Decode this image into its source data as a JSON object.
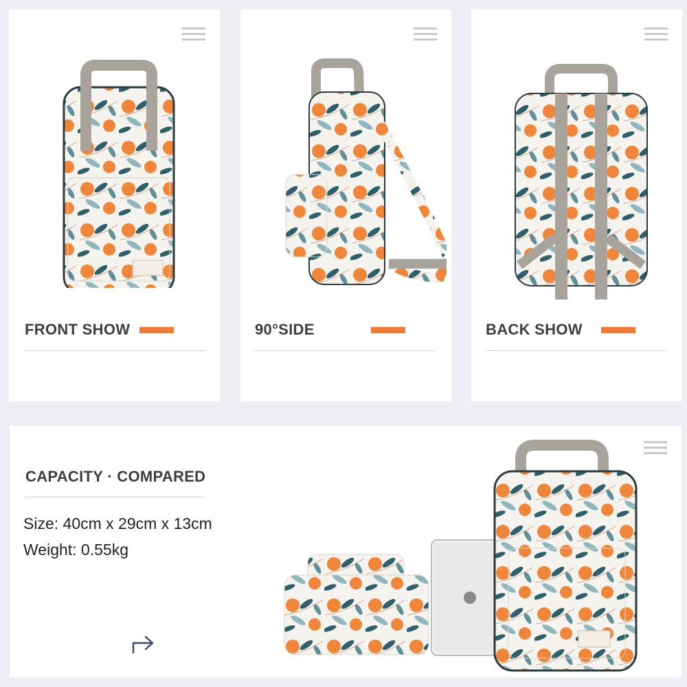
{
  "colors": {
    "page_bg": "#eeeef5",
    "accent": "#f07a3a",
    "pattern_orange": "#f0863a",
    "pattern_leaf": "#2f5f6a",
    "pattern_leaf_light": "#8fb7bd",
    "strap": "#a9a49b",
    "text": "#3e3e3e"
  },
  "views": [
    {
      "label": "FRONT SHOW",
      "icon": "menu-icon"
    },
    {
      "label": "90°SIDE",
      "icon": "menu-icon"
    },
    {
      "label": "BACK SHOW",
      "icon": "menu-icon"
    }
  ],
  "capacity": {
    "heading": "CAPACITY · COMPARED",
    "size": "Size: 40cm x 29cm x 13cm",
    "weight": "Weight: 0.55kg",
    "icon": "share-arrow-icon"
  }
}
